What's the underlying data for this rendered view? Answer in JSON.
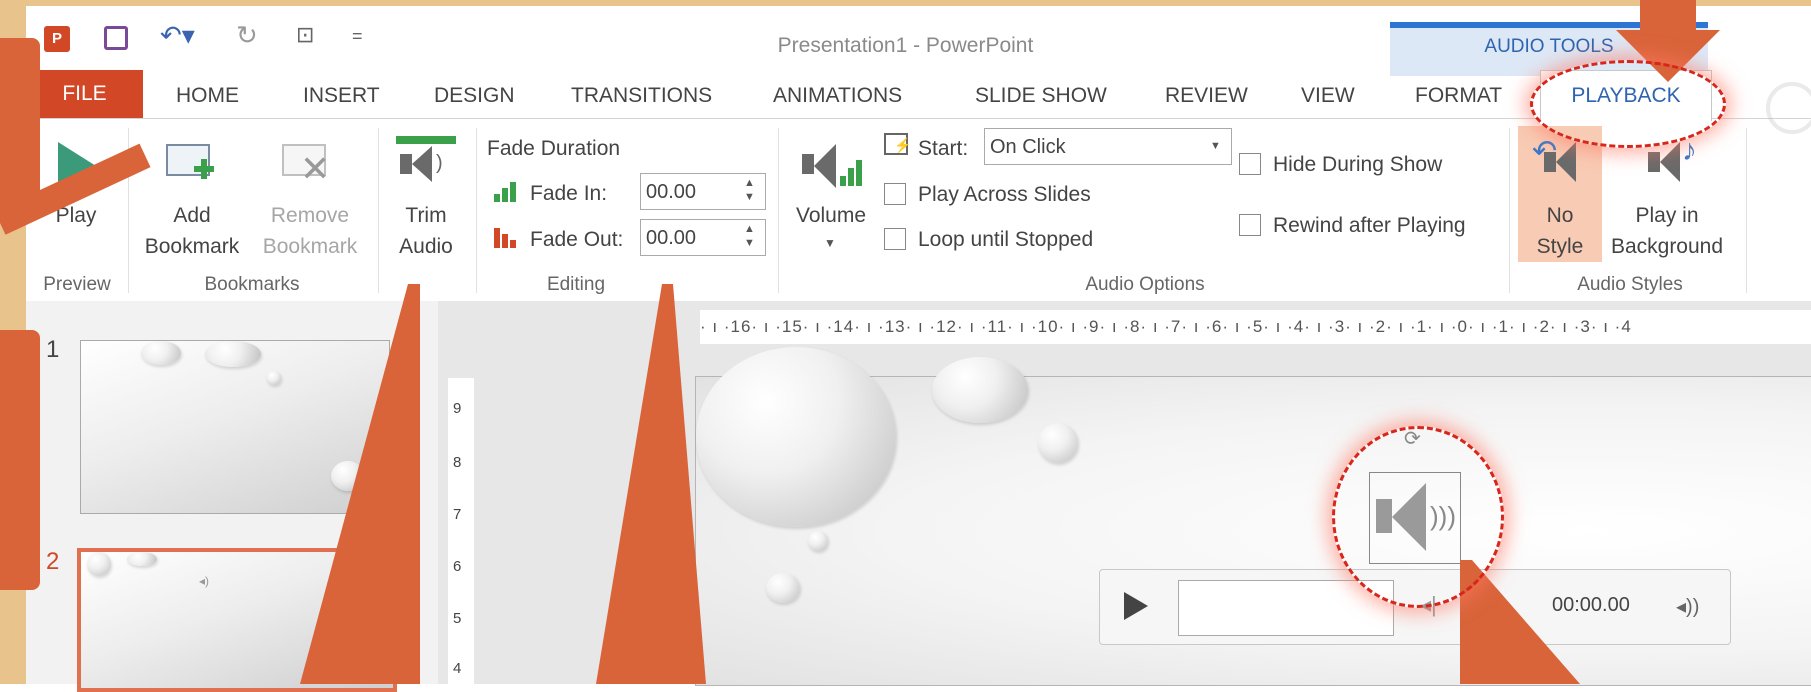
{
  "window": {
    "title": "Presentation1 - PowerPoint"
  },
  "qat": {
    "undo_icon": "undo-icon",
    "redo_icon": "redo-icon"
  },
  "context_tools": {
    "label": "AUDIO TOOLS"
  },
  "tabs": {
    "file": "FILE",
    "items": [
      "HOME",
      "INSERT",
      "DESIGN",
      "TRANSITIONS",
      "ANIMATIONS",
      "SLIDE SHOW",
      "REVIEW",
      "VIEW",
      "FORMAT"
    ],
    "active": "PLAYBACK"
  },
  "ribbon": {
    "preview": {
      "group": "Preview",
      "play": "Play"
    },
    "bookmarks": {
      "group": "Bookmarks",
      "add_1": "Add",
      "add_2": "Bookmark",
      "remove_1": "Remove",
      "remove_2": "Bookmark"
    },
    "trim": {
      "line1": "Trim",
      "line2": "Audio"
    },
    "editing": {
      "group": "Editing",
      "fade_duration": "Fade Duration",
      "fade_in_label": "Fade In:",
      "fade_in_value": "00.00",
      "fade_out_label": "Fade Out:",
      "fade_out_value": "00.00"
    },
    "volume": {
      "label": "Volume"
    },
    "audio_options": {
      "group": "Audio Options",
      "start_label": "Start:",
      "start_value": "On Click",
      "play_across": "Play Across Slides",
      "loop": "Loop until Stopped",
      "hide": "Hide During Show",
      "rewind": "Rewind after Playing"
    },
    "audio_styles": {
      "group": "Audio Styles",
      "no_style_1": "No",
      "no_style_2": "Style",
      "bg_1": "Play in",
      "bg_2": "Background"
    }
  },
  "slides_pane": {
    "numbers": [
      "1",
      "2"
    ]
  },
  "ruler": {
    "h_ticks": "· ı ·16· ı ·15· ı ·14· ı ·13· ı ·12· ı ·11· ı ·10· ı ·9· ı ·8· ı ·7· ı ·6· ı ·5· ı ·4· ı ·3· ı ·2· ı ·1· ı ·0· ı ·1· ı ·2· ı ·3· ı ·4",
    "v_ticks": [
      "9",
      "8",
      "7",
      "6",
      "5",
      "4"
    ]
  },
  "player": {
    "time": "00:00.00"
  },
  "colors": {
    "accent": "#d24726",
    "callout": "#d9643a",
    "highlight": "#d8261a",
    "tools_blue": "#2e75d3"
  }
}
